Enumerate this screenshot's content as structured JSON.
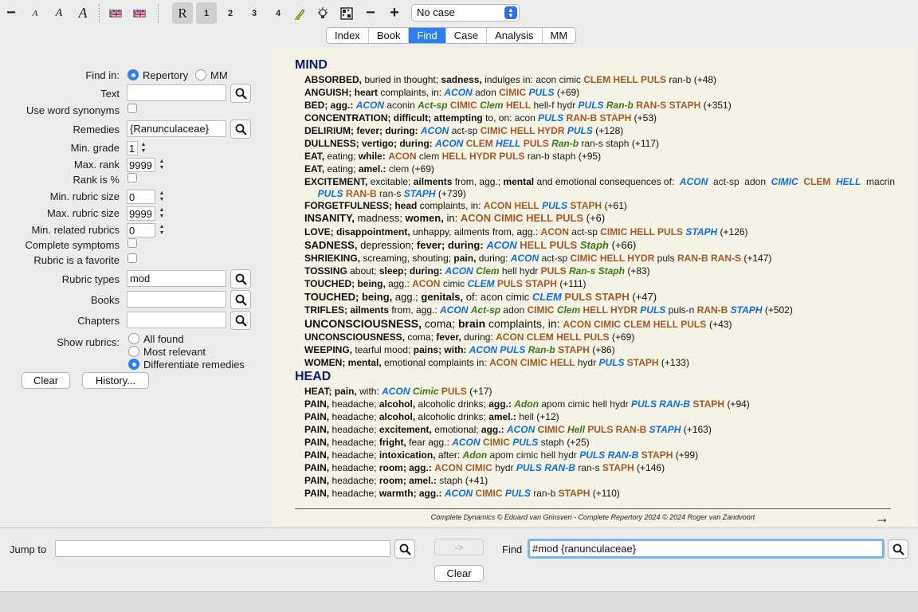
{
  "toolbar": {
    "minus_label": "−",
    "font_a1": "A",
    "font_a2": "A",
    "font_a3": "A",
    "r_label": "R",
    "n1": "1",
    "n2": "2",
    "n3": "3",
    "n4": "4",
    "zoom_out": "−",
    "zoom_in": "+",
    "case_value": "No case"
  },
  "tabs": [
    {
      "label": "Index"
    },
    {
      "label": "Book"
    },
    {
      "label": "Find"
    },
    {
      "label": "Case"
    },
    {
      "label": "Analysis"
    },
    {
      "label": "MM"
    }
  ],
  "form": {
    "find_in_label": "Find in:",
    "find_in_repertory": "Repertory",
    "find_in_mm": "MM",
    "text_label": "Text",
    "text_value": "",
    "synonyms_label": "Use word synonyms",
    "remedies_label": "Remedies",
    "remedies_value": "{Ranunculaceae}",
    "min_grade_label": "Min. grade",
    "min_grade_value": "1",
    "max_rank_label": "Max. rank",
    "max_rank_value": "9999",
    "rank_pct_label": "Rank is %",
    "min_rubric_label": "Min. rubric size",
    "min_rubric_value": "0",
    "max_rubric_label": "Max. rubric size",
    "max_rubric_value": "9999",
    "min_related_label": "Min. related rubrics",
    "min_related_value": "0",
    "complete_label": "Complete symptoms",
    "favorite_label": "Rubric is a favorite",
    "rubric_types_label": "Rubric types",
    "rubric_types_value": "mod",
    "books_label": "Books",
    "books_value": "",
    "chapters_label": "Chapters",
    "chapters_value": "",
    "show_label": "Show rubrics:",
    "show_all": "All found",
    "show_relevant": "Most relevant",
    "show_diff": "Differentiate remedies",
    "clear_label": "Clear",
    "history_label": "History..."
  },
  "results": {
    "chapter_mind": "MIND",
    "chapter_head": "HEAD",
    "footer": "Complete Dynamics © Eduard van Grinsven   -   Complete Repertory 2024 © 2024 Roger van Zandvoort",
    "next_arrow": "→"
  },
  "bottom": {
    "jump_label": "Jump to",
    "jump_value": "",
    "arrow_label": "->",
    "find_label": "Find",
    "find_value": "#mod {ranunculaceae}",
    "clear_label": "Clear"
  },
  "colors": {
    "accent": "#2a7ff3",
    "content_bg": "#f4f3e6",
    "heading": "#0e1e6b",
    "remedy_blue": "#0e6fd8",
    "remedy_brown": "#a45a25",
    "remedy_green": "#3a7a16"
  }
}
